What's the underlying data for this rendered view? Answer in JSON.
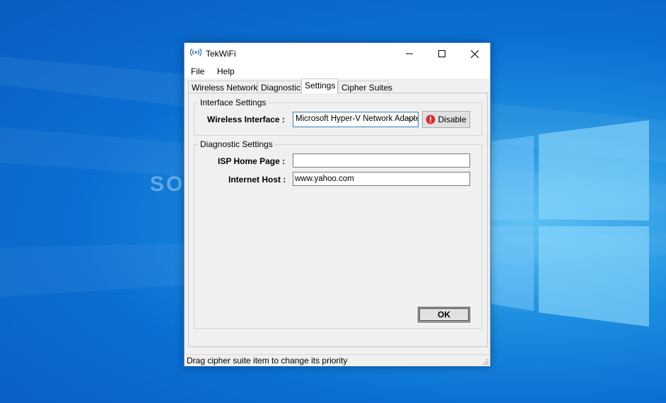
{
  "desktop": {
    "watermark": "SOFTPEDIA"
  },
  "window": {
    "title": "TekWiFi",
    "app_icon": "wifi-signal-icon",
    "controls": [
      "minimize-icon",
      "maximize-icon",
      "close-icon"
    ]
  },
  "menu": {
    "file": "File",
    "help": "Help"
  },
  "tabs": [
    {
      "label": "Wireless Networks",
      "active": false
    },
    {
      "label": "Diagnostic",
      "active": false
    },
    {
      "label": "Settings",
      "active": true
    },
    {
      "label": "Cipher Suites",
      "active": false
    }
  ],
  "interface_settings": {
    "legend": "Interface Settings",
    "wireless_interface_label": "Wireless Interface :",
    "wireless_interface_value": "Microsoft Hyper-V Network Adapter",
    "disable_label": "Disable",
    "disable_icon": "error-stop-icon"
  },
  "diagnostic_settings": {
    "legend": "Diagnostic Settings",
    "isp_home_page_label": "ISP Home Page :",
    "isp_home_page_value": "",
    "internet_host_label": "Internet Host :",
    "internet_host_value": "www.yahoo.com"
  },
  "ok_label": "OK",
  "status": {
    "text": "Drag cipher suite item to change its priority"
  },
  "colors": {
    "accent": "#3c7fb1",
    "error_red": "#d32f2f",
    "desktop_blue": "#0a6fd2"
  }
}
